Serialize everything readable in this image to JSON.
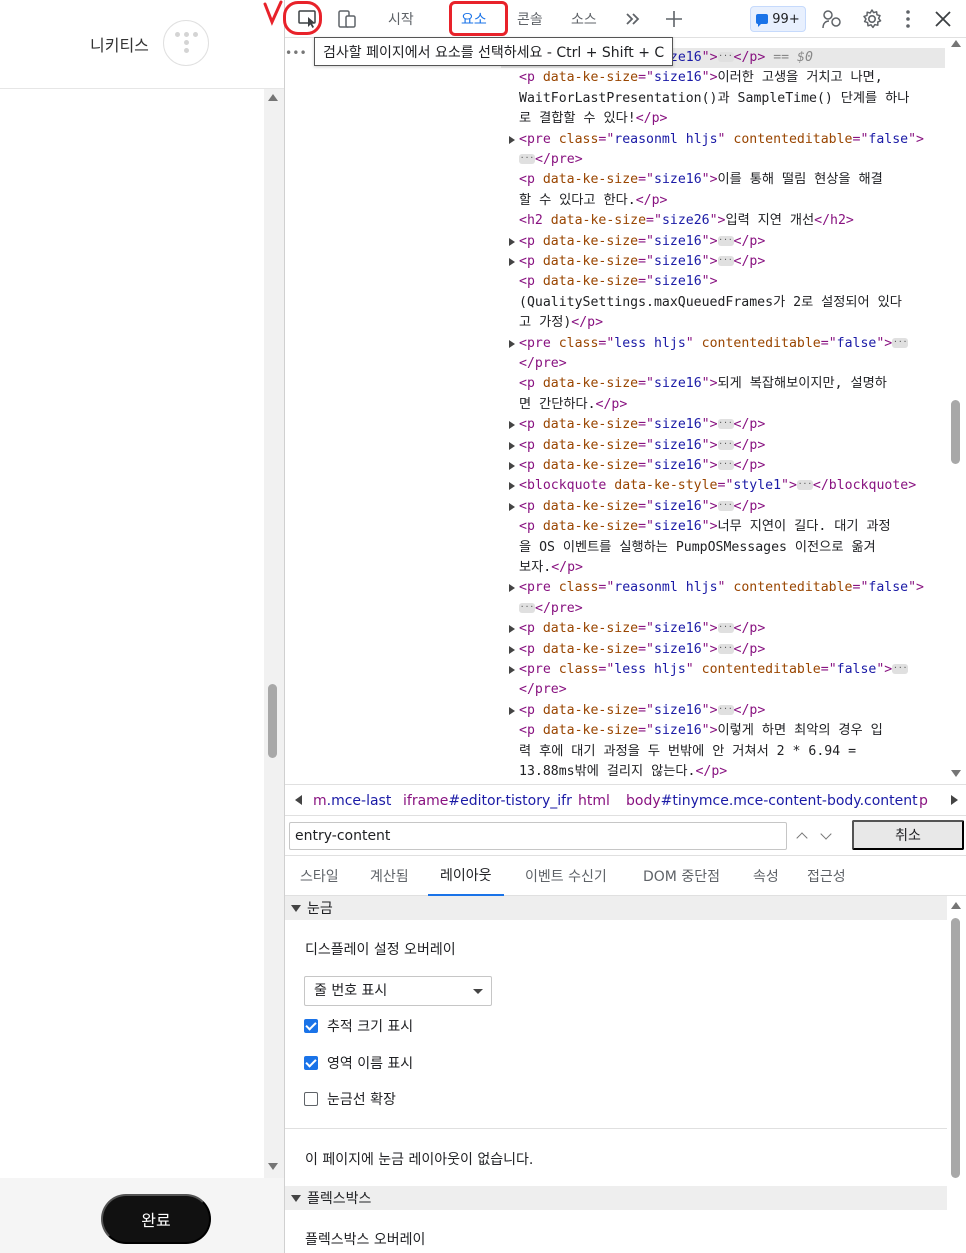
{
  "editor": {
    "nickname": "니키티스",
    "done_label": "완료"
  },
  "devtools": {
    "toolbar": {
      "tabs": [
        "시작",
        "요소",
        "콘솔",
        "소스"
      ],
      "active_tab": "요소",
      "issues_badge": "99+",
      "tooltip": "검사할 페이지에서 요소를 선택하세요 - Ctrl + Shift + C",
      "annotation_mark": "V"
    },
    "dom": {
      "lines": [
        {
          "arrow": false,
          "parts": [
            [
              "tag",
              "<p "
            ],
            [
              "an",
              "data-ke-size"
            ],
            [
              "tag",
              "=\""
            ],
            [
              "av",
              "size16"
            ],
            [
              "tag",
              "\">"
            ],
            [
              "ell",
              ""
            ],
            [
              "tag",
              "</p>"
            ],
            [
              "dim",
              " == $0"
            ]
          ]
        },
        {
          "arrow": false,
          "parts": [
            [
              "tag",
              "<p "
            ],
            [
              "an",
              "data-ke-size"
            ],
            [
              "tag",
              "=\""
            ],
            [
              "av",
              "size16"
            ],
            [
              "tag",
              "\">"
            ],
            [
              "tx",
              "이러한 고생을 거치고 나면,"
            ]
          ]
        },
        {
          "arrow": false,
          "parts": [
            [
              "tx",
              "WaitForLastPresentation()과 SampleTime() 단계를 하나"
            ]
          ]
        },
        {
          "arrow": false,
          "parts": [
            [
              "tx",
              "로 결합할 수 있다!"
            ],
            [
              "tag",
              "</p>"
            ]
          ]
        },
        {
          "arrow": true,
          "parts": [
            [
              "tag",
              "<pre "
            ],
            [
              "an",
              "class"
            ],
            [
              "tag",
              "=\""
            ],
            [
              "av",
              "reasonml hljs"
            ],
            [
              "tag",
              "\" "
            ],
            [
              "an",
              "contenteditable"
            ],
            [
              "tag",
              "=\""
            ],
            [
              "av",
              "false"
            ],
            [
              "tag",
              "\">"
            ]
          ]
        },
        {
          "arrow": false,
          "parts": [
            [
              "ell",
              ""
            ],
            [
              "tag",
              "</pre>"
            ]
          ]
        },
        {
          "arrow": false,
          "parts": [
            [
              "tag",
              "<p "
            ],
            [
              "an",
              "data-ke-size"
            ],
            [
              "tag",
              "=\""
            ],
            [
              "av",
              "size16"
            ],
            [
              "tag",
              "\">"
            ],
            [
              "tx",
              "이를 통해 떨림 현상을 해결"
            ]
          ]
        },
        {
          "arrow": false,
          "parts": [
            [
              "tx",
              "할 수 있다고 한다."
            ],
            [
              "tag",
              "</p>"
            ]
          ]
        },
        {
          "arrow": false,
          "parts": [
            [
              "tag",
              "<h2 "
            ],
            [
              "an",
              "data-ke-size"
            ],
            [
              "tag",
              "=\""
            ],
            [
              "av",
              "size26"
            ],
            [
              "tag",
              "\">"
            ],
            [
              "tx",
              "입력 지연 개선"
            ],
            [
              "tag",
              "</h2>"
            ]
          ]
        },
        {
          "arrow": true,
          "parts": [
            [
              "tag",
              "<p "
            ],
            [
              "an",
              "data-ke-size"
            ],
            [
              "tag",
              "=\""
            ],
            [
              "av",
              "size16"
            ],
            [
              "tag",
              "\">"
            ],
            [
              "ell",
              ""
            ],
            [
              "tag",
              "</p>"
            ]
          ]
        },
        {
          "arrow": true,
          "parts": [
            [
              "tag",
              "<p "
            ],
            [
              "an",
              "data-ke-size"
            ],
            [
              "tag",
              "=\""
            ],
            [
              "av",
              "size16"
            ],
            [
              "tag",
              "\">"
            ],
            [
              "ell",
              ""
            ],
            [
              "tag",
              "</p>"
            ]
          ]
        },
        {
          "arrow": false,
          "parts": [
            [
              "tag",
              "<p "
            ],
            [
              "an",
              "data-ke-size"
            ],
            [
              "tag",
              "=\""
            ],
            [
              "av",
              "size16"
            ],
            [
              "tag",
              "\">"
            ]
          ]
        },
        {
          "arrow": false,
          "parts": [
            [
              "tx",
              "(QualitySettings.maxQueuedFrames가 2로 설정되어 있다"
            ]
          ]
        },
        {
          "arrow": false,
          "parts": [
            [
              "tx",
              "고 가정)"
            ],
            [
              "tag",
              "</p>"
            ]
          ]
        },
        {
          "arrow": true,
          "parts": [
            [
              "tag",
              "<pre "
            ],
            [
              "an",
              "class"
            ],
            [
              "tag",
              "=\""
            ],
            [
              "av",
              "less hljs"
            ],
            [
              "tag",
              "\" "
            ],
            [
              "an",
              "contenteditable"
            ],
            [
              "tag",
              "=\""
            ],
            [
              "av",
              "false"
            ],
            [
              "tag",
              "\">"
            ],
            [
              "ell",
              ""
            ]
          ]
        },
        {
          "arrow": false,
          "parts": [
            [
              "tag",
              "</pre>"
            ]
          ]
        },
        {
          "arrow": false,
          "parts": [
            [
              "tag",
              "<p "
            ],
            [
              "an",
              "data-ke-size"
            ],
            [
              "tag",
              "=\""
            ],
            [
              "av",
              "size16"
            ],
            [
              "tag",
              "\">"
            ],
            [
              "tx",
              "되게 복잡해보이지만, 설명하"
            ]
          ]
        },
        {
          "arrow": false,
          "parts": [
            [
              "tx",
              "면 간단하다."
            ],
            [
              "tag",
              "</p>"
            ]
          ]
        },
        {
          "arrow": true,
          "parts": [
            [
              "tag",
              "<p "
            ],
            [
              "an",
              "data-ke-size"
            ],
            [
              "tag",
              "=\""
            ],
            [
              "av",
              "size16"
            ],
            [
              "tag",
              "\">"
            ],
            [
              "ell",
              ""
            ],
            [
              "tag",
              "</p>"
            ]
          ]
        },
        {
          "arrow": true,
          "parts": [
            [
              "tag",
              "<p "
            ],
            [
              "an",
              "data-ke-size"
            ],
            [
              "tag",
              "=\""
            ],
            [
              "av",
              "size16"
            ],
            [
              "tag",
              "\">"
            ],
            [
              "ell",
              ""
            ],
            [
              "tag",
              "</p>"
            ]
          ]
        },
        {
          "arrow": true,
          "parts": [
            [
              "tag",
              "<p "
            ],
            [
              "an",
              "data-ke-size"
            ],
            [
              "tag",
              "=\""
            ],
            [
              "av",
              "size16"
            ],
            [
              "tag",
              "\">"
            ],
            [
              "ell",
              ""
            ],
            [
              "tag",
              "</p>"
            ]
          ]
        },
        {
          "arrow": true,
          "parts": [
            [
              "tag",
              "<blockquote "
            ],
            [
              "an",
              "data-ke-style"
            ],
            [
              "tag",
              "=\""
            ],
            [
              "av",
              "style1"
            ],
            [
              "tag",
              "\">"
            ],
            [
              "ell",
              ""
            ],
            [
              "tag",
              "</blockquote>"
            ]
          ]
        },
        {
          "arrow": true,
          "parts": [
            [
              "tag",
              "<p "
            ],
            [
              "an",
              "data-ke-size"
            ],
            [
              "tag",
              "=\""
            ],
            [
              "av",
              "size16"
            ],
            [
              "tag",
              "\">"
            ],
            [
              "ell",
              ""
            ],
            [
              "tag",
              "</p>"
            ]
          ]
        },
        {
          "arrow": false,
          "parts": [
            [
              "tag",
              "<p "
            ],
            [
              "an",
              "data-ke-size"
            ],
            [
              "tag",
              "=\""
            ],
            [
              "av",
              "size16"
            ],
            [
              "tag",
              "\">"
            ],
            [
              "tx",
              "너무 지연이 길다. 대기 과정"
            ]
          ]
        },
        {
          "arrow": false,
          "parts": [
            [
              "tx",
              "을 OS 이벤트를 실행하는 PumpOSMessages 이전으로 옮겨"
            ]
          ]
        },
        {
          "arrow": false,
          "parts": [
            [
              "tx",
              "보자."
            ],
            [
              "tag",
              "</p>"
            ]
          ]
        },
        {
          "arrow": true,
          "parts": [
            [
              "tag",
              "<pre "
            ],
            [
              "an",
              "class"
            ],
            [
              "tag",
              "=\""
            ],
            [
              "av",
              "reasonml hljs"
            ],
            [
              "tag",
              "\" "
            ],
            [
              "an",
              "contenteditable"
            ],
            [
              "tag",
              "=\""
            ],
            [
              "av",
              "false"
            ],
            [
              "tag",
              "\">"
            ]
          ]
        },
        {
          "arrow": false,
          "parts": [
            [
              "ell",
              ""
            ],
            [
              "tag",
              "</pre>"
            ]
          ]
        },
        {
          "arrow": true,
          "parts": [
            [
              "tag",
              "<p "
            ],
            [
              "an",
              "data-ke-size"
            ],
            [
              "tag",
              "=\""
            ],
            [
              "av",
              "size16"
            ],
            [
              "tag",
              "\">"
            ],
            [
              "ell",
              ""
            ],
            [
              "tag",
              "</p>"
            ]
          ]
        },
        {
          "arrow": true,
          "parts": [
            [
              "tag",
              "<p "
            ],
            [
              "an",
              "data-ke-size"
            ],
            [
              "tag",
              "=\""
            ],
            [
              "av",
              "size16"
            ],
            [
              "tag",
              "\">"
            ],
            [
              "ell",
              ""
            ],
            [
              "tag",
              "</p>"
            ]
          ]
        },
        {
          "arrow": true,
          "parts": [
            [
              "tag",
              "<pre "
            ],
            [
              "an",
              "class"
            ],
            [
              "tag",
              "=\""
            ],
            [
              "av",
              "less hljs"
            ],
            [
              "tag",
              "\" "
            ],
            [
              "an",
              "contenteditable"
            ],
            [
              "tag",
              "=\""
            ],
            [
              "av",
              "false"
            ],
            [
              "tag",
              "\">"
            ],
            [
              "ell",
              ""
            ]
          ]
        },
        {
          "arrow": false,
          "parts": [
            [
              "tag",
              "</pre>"
            ]
          ]
        },
        {
          "arrow": true,
          "parts": [
            [
              "tag",
              "<p "
            ],
            [
              "an",
              "data-ke-size"
            ],
            [
              "tag",
              "=\""
            ],
            [
              "av",
              "size16"
            ],
            [
              "tag",
              "\">"
            ],
            [
              "ell",
              ""
            ],
            [
              "tag",
              "</p>"
            ]
          ]
        },
        {
          "arrow": false,
          "parts": [
            [
              "tag",
              "<p "
            ],
            [
              "an",
              "data-ke-size"
            ],
            [
              "tag",
              "=\""
            ],
            [
              "av",
              "size16"
            ],
            [
              "tag",
              "\">"
            ],
            [
              "tx",
              "이렇게 하면 최악의 경우 입"
            ]
          ]
        },
        {
          "arrow": false,
          "parts": [
            [
              "tx",
              "력 후에 대기 과정을 두 번밖에 안 거쳐서 2 * 6.94 ="
            ]
          ]
        },
        {
          "arrow": false,
          "parts": [
            [
              "tx",
              "13.88ms밖에 걸리지 않는다."
            ],
            [
              "tag",
              "</p>"
            ]
          ]
        }
      ]
    },
    "breadcrumbs": [
      {
        "tag": "m",
        "rest": ".mce-last"
      },
      {
        "tag": "iframe",
        "rest": "#editor-tistory_ifr"
      },
      {
        "tag": "html",
        "rest": ""
      },
      {
        "tag": "body",
        "rest": "#tinymce.mce-content-body.content"
      },
      {
        "tag": "p",
        "rest": ""
      }
    ],
    "search": {
      "value": "entry-content",
      "cancel_label": "취소"
    },
    "subtabs": [
      "스타일",
      "계산됨",
      "레이아웃",
      "이벤트 수신기",
      "DOM 중단점",
      "속성",
      "접근성"
    ],
    "active_subtab": "레이아웃",
    "layout": {
      "grid_section": "눈금",
      "overlay_heading": "디스플레이 설정 오버레이",
      "overlay_select": "줄 번호 표시",
      "checkboxes": [
        {
          "label": "추적 크기 표시",
          "checked": true
        },
        {
          "label": "영역 이름 표시",
          "checked": true
        },
        {
          "label": "눈금선 확장",
          "checked": false
        }
      ],
      "no_grid_message": "이 페이지에 눈금 레이아웃이 없습니다.",
      "flex_section": "플렉스박스",
      "flex_overlay_heading": "플렉스박스 오버레이"
    },
    "colors": {
      "accent": "#1a73e8",
      "annotation_red": "#e8222a",
      "tag": "#881280",
      "attr_name": "#994500",
      "attr_value": "#1a1aa6"
    }
  }
}
